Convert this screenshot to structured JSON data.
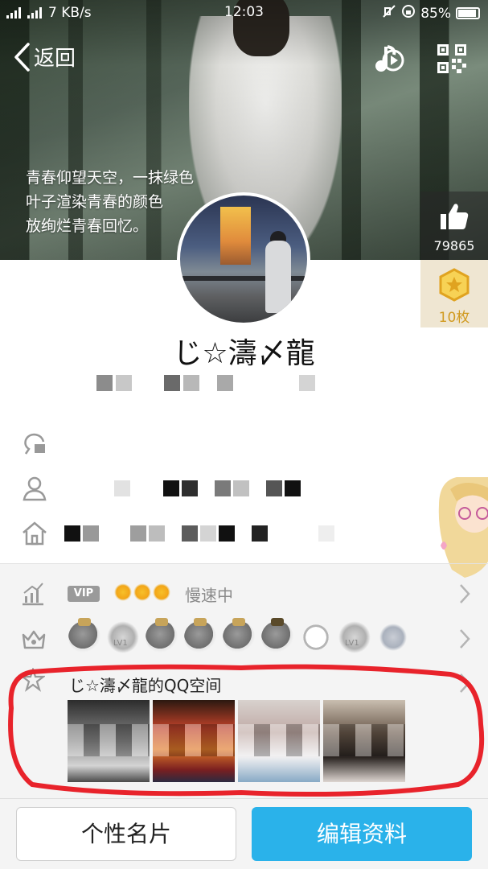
{
  "status_bar": {
    "net_speed": "7 KB/s",
    "time": "12:03",
    "battery": "85%",
    "signal_labels": [
      "2G",
      "4G"
    ]
  },
  "header": {
    "back_label": "返回",
    "cover_text": [
      "青春仰望天空，一抹绿色",
      "叶子渲染青春的颜色",
      "放绚烂青春回忆。"
    ]
  },
  "side": {
    "likes": "79865",
    "badge_count": "10枚"
  },
  "profile": {
    "nickname": "じ☆濤〆龍"
  },
  "vip": {
    "tag": "VIP",
    "status": "慢速中"
  },
  "badge_row": {
    "labels": [
      "LV1",
      "LV1"
    ]
  },
  "qzone": {
    "title": "じ☆濤〆龍的QQ空间"
  },
  "actions": {
    "card_label": "个性名片",
    "edit_label": "编辑资料"
  },
  "colors": {
    "accent_blue": "#2ab2ea",
    "highlight_red": "#e8232b",
    "badge_gold": "#d19a1f"
  }
}
